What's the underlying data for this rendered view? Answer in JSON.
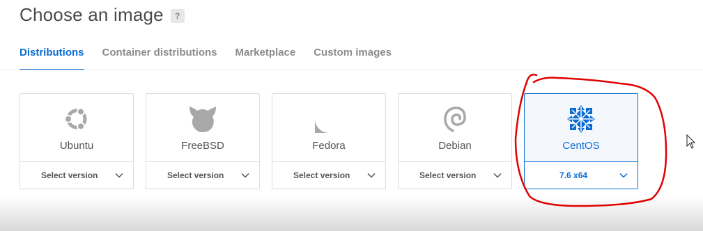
{
  "header": {
    "title": "Choose an image",
    "help_badge": "?"
  },
  "tabs": [
    {
      "label": "Distributions",
      "active": true
    },
    {
      "label": "Container distributions",
      "active": false
    },
    {
      "label": "Marketplace",
      "active": false
    },
    {
      "label": "Custom images",
      "active": false
    }
  ],
  "images": [
    {
      "name": "Ubuntu",
      "version": "Select version",
      "icon": "ubuntu-logo-icon",
      "selected": false
    },
    {
      "name": "FreeBSD",
      "version": "Select version",
      "icon": "freebsd-logo-icon",
      "selected": false
    },
    {
      "name": "Fedora",
      "version": "Select version",
      "icon": "fedora-logo-icon",
      "selected": false
    },
    {
      "name": "Debian",
      "version": "Select version",
      "icon": "debian-logo-icon",
      "selected": false
    },
    {
      "name": "CentOS",
      "version": "7.6 x64",
      "icon": "centos-logo-icon",
      "selected": true
    }
  ],
  "colors": {
    "accent": "#0a6cd2",
    "annotation": "#e00000",
    "icon_gray": "#a8a8a8"
  }
}
